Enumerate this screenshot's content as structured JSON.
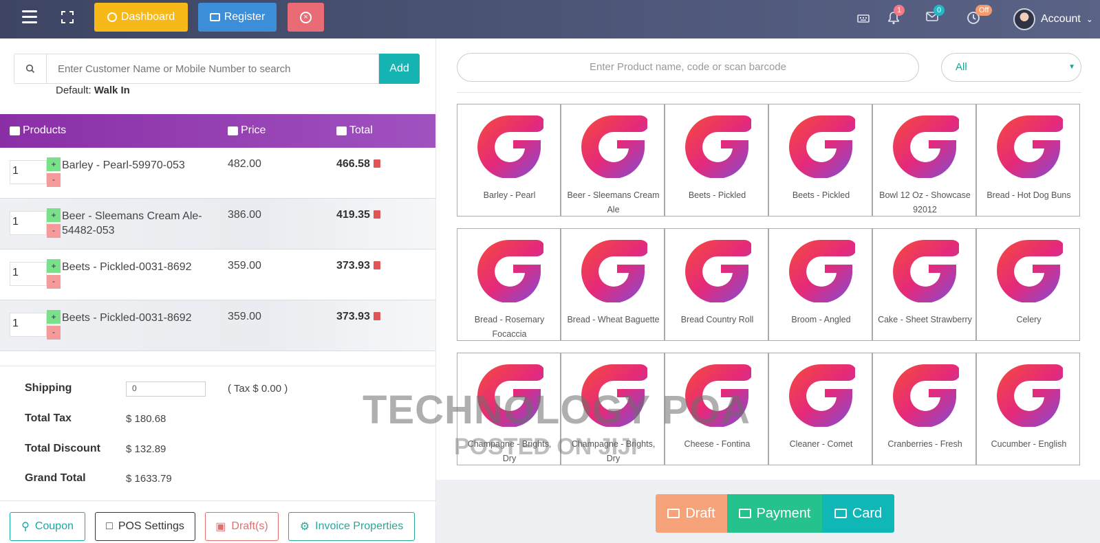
{
  "topbar": {
    "dashboard_label": "Dashboard",
    "register_label": "Register",
    "notif_count": "1",
    "mail_count": "0",
    "clock_status": "Off",
    "account_label": "Account"
  },
  "customer": {
    "placeholder": "Enter Customer Name or Mobile Number to search",
    "add_label": "Add",
    "default_prefix": "Default:",
    "default_value": "Walk In"
  },
  "table": {
    "headers": {
      "products": "Products",
      "price": "Price",
      "total": "Total"
    },
    "rows": [
      {
        "qty": "1",
        "name": "Barley - Pearl-59970-053",
        "price": "482.00",
        "total": "466.58"
      },
      {
        "qty": "1",
        "name": "Beer - Sleemans Cream Ale-54482-053",
        "price": "386.00",
        "total": "419.35"
      },
      {
        "qty": "1",
        "name": "Beets - Pickled-0031-8692",
        "price": "359.00",
        "total": "373.93"
      },
      {
        "qty": "1",
        "name": "Beets - Pickled-0031-8692",
        "price": "359.00",
        "total": "373.93"
      }
    ]
  },
  "summary": {
    "shipping_label": "Shipping",
    "shipping_value": "0",
    "tax_note": "( Tax $ 0.00 )",
    "total_tax_label": "Total Tax",
    "total_tax": "$ 180.68",
    "total_discount_label": "Total Discount",
    "total_discount": "$ 132.89",
    "grand_total_label": "Grand Total",
    "grand_total": "$ 1633.79"
  },
  "bottom_buttons": {
    "coupon": "Coupon",
    "pos_settings": "POS Settings",
    "drafts": "Draft(s)",
    "invoice_properties": "Invoice Properties"
  },
  "product_search": {
    "placeholder": "Enter Product name, code or scan barcode",
    "category_selected": "All"
  },
  "products": [
    "Barley - Pearl",
    "Beer - Sleemans Cream Ale",
    "Beets - Pickled",
    "Beets - Pickled",
    "Bowl 12 Oz - Showcase 92012",
    "Bread - Hot Dog Buns",
    "Bread - Rosemary Focaccia",
    "Bread - Wheat Baguette",
    "Bread Country Roll",
    "Broom - Angled",
    "Cake - Sheet Strawberry",
    "Celery",
    "Champagne - Brights, Dry",
    "Champagne - Brights, Dry",
    "Cheese - Fontina",
    "Cleaner - Comet",
    "Cranberries - Fresh",
    "Cucumber - English"
  ],
  "payment": {
    "draft": "Draft",
    "payment": "Payment",
    "card": "Card"
  },
  "watermark": {
    "line1": "TECHNOLOGY POA",
    "line2": "POSTED ON JIJI"
  },
  "colors": {
    "topbar": "#4a5373",
    "dashboard": "#f6b917",
    "register": "#3d8ed9",
    "close": "#e96b76",
    "add": "#15b3b1",
    "header_purple": "#8a2ea6",
    "pay_draft": "#f6a37a",
    "pay_payment": "#26c28e",
    "pay_card": "#10b7b7"
  }
}
